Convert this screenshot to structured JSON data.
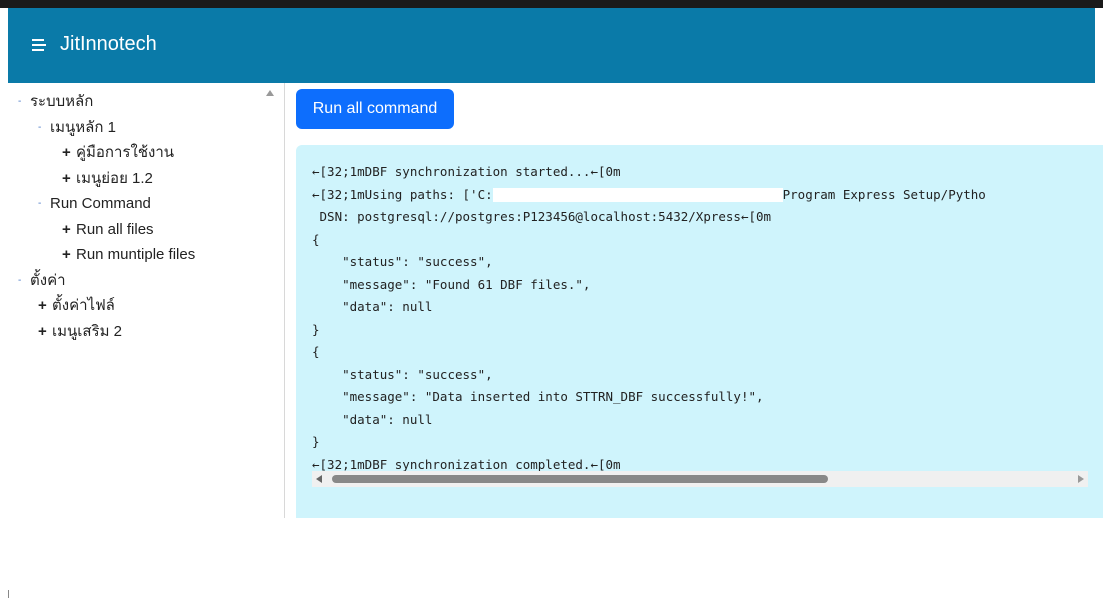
{
  "app": {
    "title": "JitInnotech",
    "header_color": "#0a7aa8",
    "menu_icon": "hamburger-menu-icon"
  },
  "sidebar": {
    "tree": [
      {
        "label": "ระบบหลัก",
        "level": 0,
        "marker": "-"
      },
      {
        "label": "เมนูหลัก 1",
        "level": 1,
        "marker": "-"
      },
      {
        "label": "คู่มือการใช้งาน",
        "level": 2,
        "marker": "+"
      },
      {
        "label": "เมนูย่อย 1.2",
        "level": 2,
        "marker": "+"
      },
      {
        "label": "Run Command",
        "level": 1,
        "marker": "-"
      },
      {
        "label": "Run all files",
        "level": 2,
        "marker": "+"
      },
      {
        "label": "Run muntiple files",
        "level": 2,
        "marker": "+"
      },
      {
        "label": "ตั้งค่า",
        "level": 0,
        "marker": "-"
      },
      {
        "label": "ตั้งค่าไฟล์",
        "level": 1,
        "marker": "+"
      },
      {
        "label": "เมนูเสริม 2",
        "level": 1,
        "marker": "+"
      }
    ]
  },
  "main": {
    "run_button_label": "Run all command",
    "run_button_color": "#0d6efd",
    "console_background": "#cff4fc",
    "output": {
      "line1": "←[32;1mDBF synchronization started...←[0m",
      "line2_prefix": "←[32;1mUsing paths: ['C:",
      "line2_suffix": "Program Express Setup/Pytho",
      "line3": " DSN: postgresql://postgres:P123456@localhost:5432/Xpress←[0m",
      "line4": "{",
      "line5": "    \"status\": \"success\",",
      "line6": "    \"message\": \"Found 61 DBF files.\",",
      "line7": "    \"data\": null",
      "line8": "}",
      "line9": "{",
      "line10": "    \"status\": \"success\",",
      "line11": "    \"message\": \"Data inserted into STTRN_DBF successfully!\",",
      "line12": "    \"data\": null",
      "line13": "}",
      "line14": "←[32;1mDBF synchronization completed.←[0m"
    },
    "scroll_position_fraction": 0.0
  }
}
